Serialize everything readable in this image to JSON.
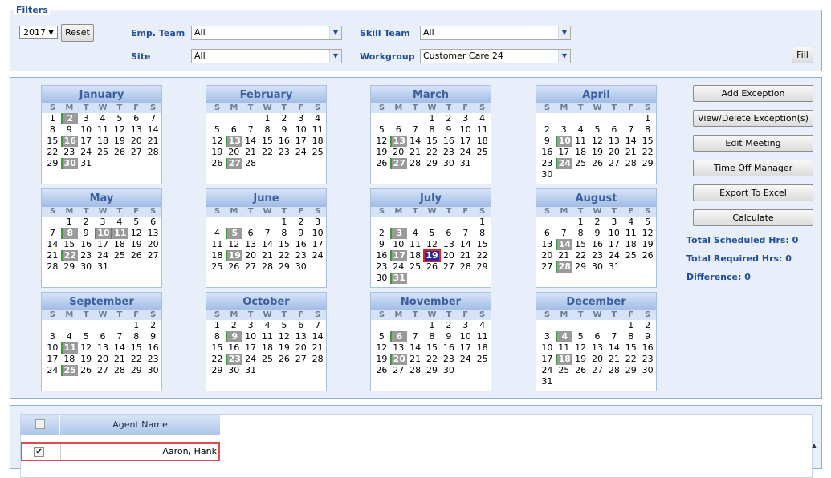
{
  "filters": {
    "legend": "Filters",
    "year": "2017",
    "reset_label": "Reset",
    "emp_team_label": "Emp. Team",
    "emp_team_value": "All",
    "site_label": "Site",
    "site_value": "All",
    "skill_team_label": "Skill Team",
    "skill_team_value": "All",
    "workgroup_label": "Workgroup",
    "workgroup_value": "Customer Care 24",
    "fill_label": "Fill"
  },
  "actions": {
    "add_exception": "Add Exception",
    "view_delete_exceptions": "View/Delete Exception(s)",
    "edit_meeting": "Edit Meeting",
    "time_off_manager": "Time Off Manager",
    "export_excel": "Export To Excel",
    "calculate": "Calculate"
  },
  "stats": {
    "total_scheduled": "Total Scheduled Hrs: 0",
    "total_required": "Total Required Hrs: 0",
    "difference": "Difference: 0"
  },
  "weekday_headers": [
    "S",
    "M",
    "T",
    "W",
    "T",
    "F",
    "S"
  ],
  "months": [
    {
      "name": "January",
      "start": 0,
      "days": 31,
      "marked": [
        2,
        16,
        30
      ]
    },
    {
      "name": "February",
      "start": 3,
      "days": 28,
      "marked": [
        13,
        27
      ]
    },
    {
      "name": "March",
      "start": 3,
      "days": 31,
      "marked": [
        13,
        27
      ]
    },
    {
      "name": "April",
      "start": 6,
      "days": 30,
      "marked": [
        10,
        24
      ]
    },
    {
      "name": "May",
      "start": 1,
      "days": 31,
      "marked": [
        8,
        10,
        11,
        22
      ]
    },
    {
      "name": "June",
      "start": 4,
      "days": 30,
      "marked": [
        5,
        19
      ]
    },
    {
      "name": "July",
      "start": 6,
      "days": 31,
      "marked": [
        3,
        17,
        31
      ],
      "today": 19
    },
    {
      "name": "August",
      "start": 2,
      "days": 31,
      "marked": [
        14,
        28
      ]
    },
    {
      "name": "September",
      "start": 5,
      "days": 30,
      "marked": [
        11,
        25
      ]
    },
    {
      "name": "October",
      "start": 0,
      "days": 31,
      "marked": [
        9,
        23
      ]
    },
    {
      "name": "November",
      "start": 3,
      "days": 30,
      "marked": [
        6,
        20
      ]
    },
    {
      "name": "December",
      "start": 5,
      "days": 31,
      "marked": [
        4,
        18
      ]
    }
  ],
  "agent_grid": {
    "column_name": "Agent Name",
    "rows": [
      {
        "name": "Aaron, Hank",
        "checked": true
      }
    ]
  },
  "colors": {
    "accent": "#1f4d9c",
    "exception_day": "#9a9a9a",
    "today_fill": "#2a2a9a",
    "highlight_border": "#e14b4b"
  }
}
